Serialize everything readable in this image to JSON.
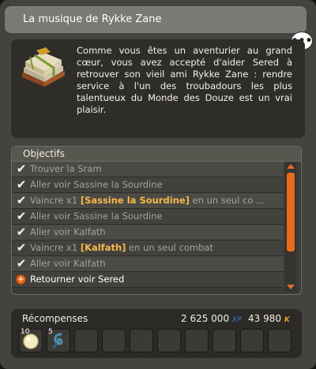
{
  "window": {
    "title": "La musique de Rykke Zane",
    "speech_icon": "speech-bubble-icon",
    "speech_text": "•••"
  },
  "description": {
    "icon": "quest-book-icon",
    "text": "Comme vous êtes un aventurier au grand cœur, vous avez accepté d'aider Sered à retrouver son vieil ami Rykke Zane : rendre service à l'un des troubadours les plus talentueux du Monde des Douze est un vrai plaisir."
  },
  "objectives": {
    "header": "Objectifs",
    "items": [
      {
        "state": "done",
        "text": "Trouver la Sram"
      },
      {
        "state": "done",
        "text": "Aller voir Sassine la Sourdine"
      },
      {
        "state": "done",
        "prefix": "Vaincre x1 ",
        "highlight": "[Sassine la Sourdine]",
        "suffix": " en un seul co ..."
      },
      {
        "state": "done",
        "text": "Aller voir Sassine la Sourdine"
      },
      {
        "state": "done",
        "text": "Aller voir Kalfath"
      },
      {
        "state": "done",
        "prefix": "Vaincre x1 ",
        "highlight": "[Kalfath]",
        "suffix": " en un seul combat"
      },
      {
        "state": "done",
        "text": "Aller voir Kalfath"
      },
      {
        "state": "active",
        "text": "Retourner voir Sered"
      }
    ]
  },
  "rewards": {
    "label": "Récompenses",
    "xp_value": "2 625 000",
    "xp_unit": "XP",
    "kamas_value": "43 980",
    "kamas_unit": "K",
    "items": [
      {
        "qty": "10",
        "icon": "moon-orb-icon"
      },
      {
        "qty": "5",
        "icon": "blue-hook-icon"
      },
      {},
      {},
      {},
      {},
      {},
      {},
      {},
      {},
      {}
    ]
  },
  "colors": {
    "accent_orange": "#e86d1a",
    "highlight_gold": "#f6b94b",
    "xp_blue": "#2f82d4",
    "kamas_gold": "#f0a21c"
  }
}
